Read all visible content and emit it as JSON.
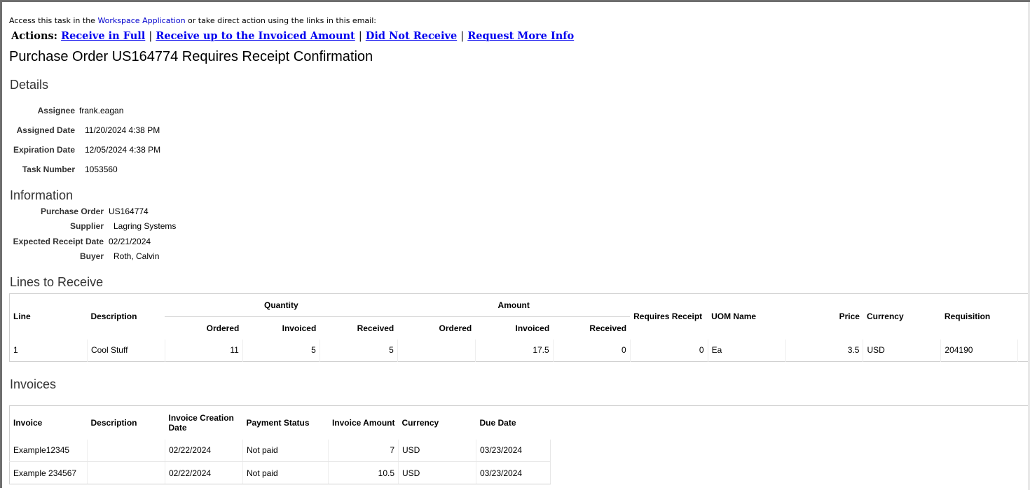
{
  "access": {
    "prefix": "Access this task in the",
    "link": "Workspace Application",
    "suffix": "or take direct action using the links in this email:"
  },
  "actions": {
    "label": "Actions:",
    "items": [
      "Receive in Full",
      "Receive up to the Invoiced Amount",
      "Did Not Receive",
      "Request More Info"
    ],
    "separator": "|"
  },
  "page_title": "Purchase Order US164774 Requires Receipt Confirmation",
  "details": {
    "heading": "Details",
    "rows": [
      {
        "label": "Assignee",
        "value": "frank.eagan"
      },
      {
        "label": "Assigned Date",
        "value": "11/20/2024 4:38 PM"
      },
      {
        "label": "Expiration Date",
        "value": "12/05/2024 4:38 PM"
      },
      {
        "label": "Task Number",
        "value": "1053560"
      }
    ]
  },
  "information": {
    "heading": "Information",
    "rows": [
      {
        "label": "Purchase Order",
        "value": "US164774"
      },
      {
        "label": "Supplier",
        "value": "Lagring Systems"
      },
      {
        "label": "Expected Receipt Date",
        "value": "02/21/2024"
      },
      {
        "label": "Buyer",
        "value": "Roth, Calvin"
      }
    ]
  },
  "lines": {
    "heading": "Lines to Receive",
    "headers": {
      "line": "Line",
      "description": "Description",
      "quantity": "Quantity",
      "amount": "Amount",
      "ordered": "Ordered",
      "invoiced": "Invoiced",
      "received": "Received",
      "requires_receipt": "Requires Receipt",
      "uom": "UOM Name",
      "price": "Price",
      "currency": "Currency",
      "requisition": "Requisition"
    },
    "rows": [
      {
        "line": "1",
        "description": "Cool Stuff",
        "q_ordered": "11",
        "q_invoiced": "5",
        "q_received": "5",
        "a_ordered": "",
        "a_invoiced": "17.5",
        "a_received": "0",
        "requires_receipt": "0",
        "uom": "Ea",
        "price": "3.5",
        "currency": "USD",
        "requisition": "204190"
      }
    ]
  },
  "invoices": {
    "heading": "Invoices",
    "headers": {
      "invoice": "Invoice",
      "description": "Description",
      "creation_date": "Invoice Creation Date",
      "payment_status": "Payment Status",
      "amount": "Invoice Amount",
      "currency": "Currency",
      "due_date": "Due Date"
    },
    "rows": [
      {
        "invoice": "Example12345",
        "description": "",
        "creation_date": "02/22/2024",
        "payment_status": "Not paid",
        "amount": "7",
        "currency": "USD",
        "due_date": "03/23/2024"
      },
      {
        "invoice": "Example 234567",
        "description": "",
        "creation_date": "02/22/2024",
        "payment_status": "Not paid",
        "amount": "10.5",
        "currency": "USD",
        "due_date": "03/23/2024"
      }
    ]
  },
  "colors": {
    "link": "#0000ee",
    "border": "#d0d0d0",
    "frame": "#6e6e6e"
  }
}
